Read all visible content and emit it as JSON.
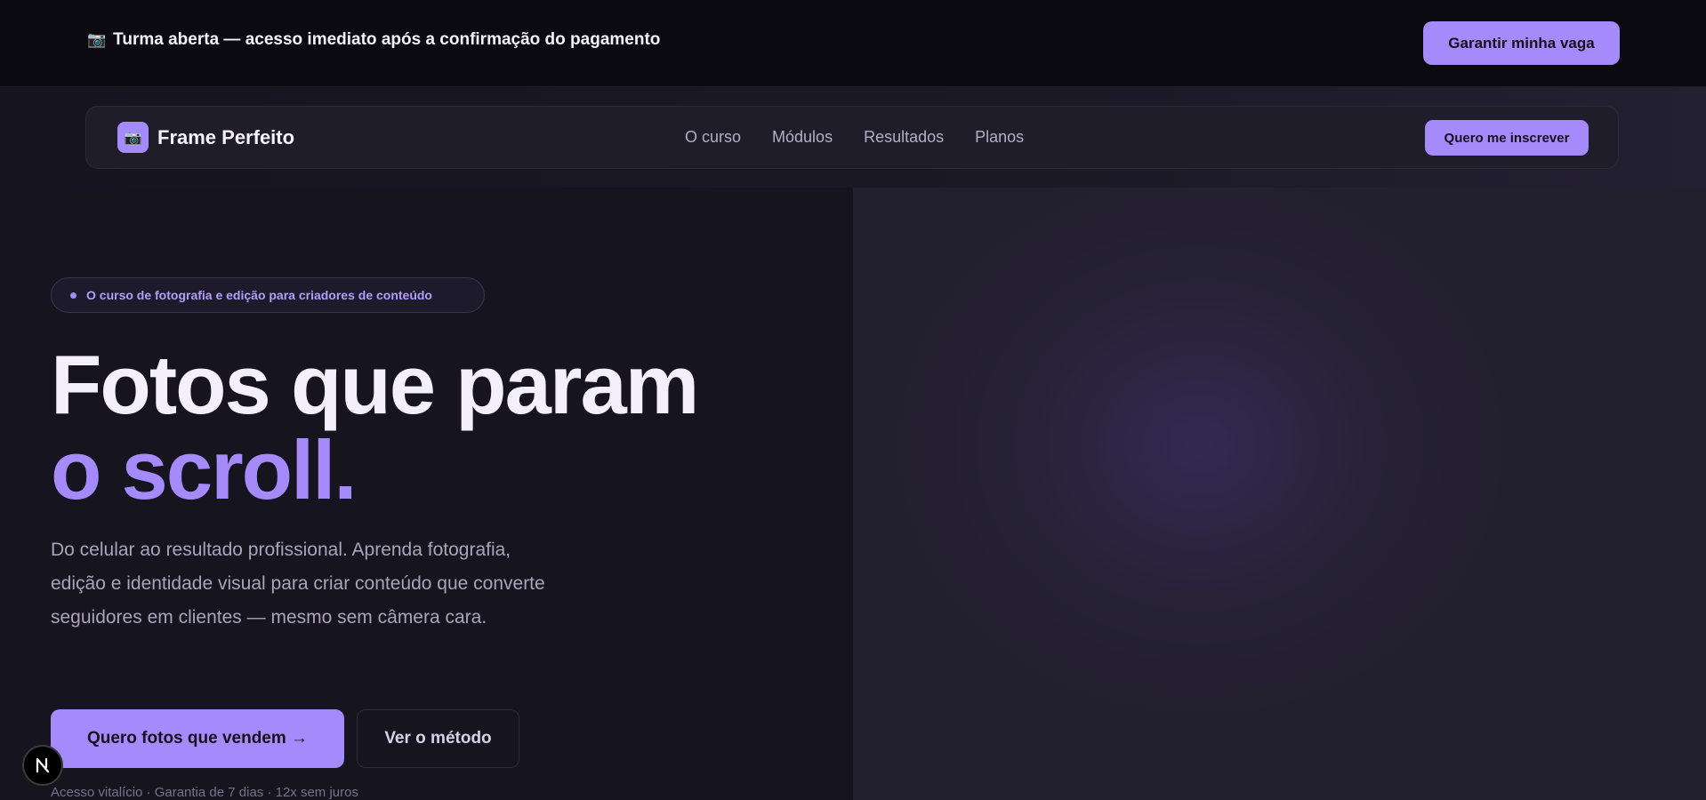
{
  "announcement": {
    "icon": "camera-icon",
    "text": "Turma aberta — acesso imediato após a confirmação do pagamento",
    "cta_label": "Garantir minha vaga"
  },
  "nav": {
    "logo_icon": "camera-icon",
    "brand": "Frame Perfeito",
    "links": [
      "O curso",
      "Módulos",
      "Resultados",
      "Planos"
    ],
    "cta_label": "Quero me inscrever"
  },
  "hero": {
    "pill_text": "O curso de fotografia e edição para criadores de conteúdo",
    "headline_line1": "Fotos que param",
    "headline_line2": "o scroll.",
    "subtext": "Do celular ao resultado profissional. Aprenda fotografia, edição e identidade visual para criar conteúdo que converte seguidores em clientes — mesmo sem câmera cara.",
    "primary_cta": "Quero fotos que vendem →",
    "secondary_cta": "Ver o método",
    "footnote": "Acesso vitalício · Garantia de 7 dias · 12x sem juros"
  },
  "dev_badge": {
    "letter": "N"
  },
  "colors": {
    "accent": "#a48afa",
    "background": "#16141f",
    "topbar": "#0b0a10"
  }
}
